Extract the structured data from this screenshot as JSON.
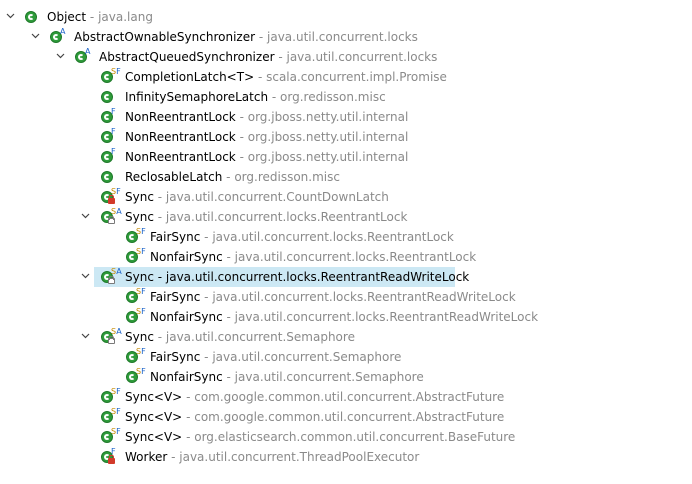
{
  "tree": {
    "rows": [
      {
        "name": "Object",
        "pkg": "- java.lang",
        "expanded": true,
        "icon": "class-icon",
        "mods": ""
      },
      {
        "name": "AbstractOwnableSynchronizer",
        "pkg": "- java.util.concurrent.locks",
        "expanded": true,
        "icon": "abstract-class-icon",
        "mods": "A"
      },
      {
        "name": "AbstractQueuedSynchronizer",
        "pkg": "- java.util.concurrent.locks",
        "expanded": true,
        "icon": "abstract-class-icon",
        "mods": "A"
      },
      {
        "name": "CompletionLatch<T>",
        "pkg": "- scala.concurrent.impl.Promise",
        "icon": "static-final-class-icon",
        "mods": "SF"
      },
      {
        "name": "InfinitySemaphoreLatch",
        "pkg": "- org.redisson.misc",
        "icon": "class-icon",
        "mods": ""
      },
      {
        "name": "NonReentrantLock",
        "pkg": "- org.jboss.netty.util.internal",
        "icon": "final-class-icon",
        "mods": "F"
      },
      {
        "name": "NonReentrantLock",
        "pkg": "- org.jboss.netty.util.internal",
        "icon": "final-class-icon",
        "mods": "F"
      },
      {
        "name": "NonReentrantLock",
        "pkg": "- org.jboss.netty.util.internal",
        "icon": "final-class-icon",
        "mods": "F"
      },
      {
        "name": "ReclosableLatch",
        "pkg": "- org.redisson.misc",
        "icon": "class-icon",
        "mods": ""
      },
      {
        "name": "Sync",
        "pkg": "- java.util.concurrent.CountDownLatch",
        "icon": "private-static-final-class-icon",
        "mods": "SF"
      },
      {
        "name": "Sync",
        "pkg": "- java.util.concurrent.locks.ReentrantLock",
        "expanded": true,
        "icon": "static-abstract-class-icon",
        "mods": "SA"
      },
      {
        "name": "FairSync",
        "pkg": "- java.util.concurrent.locks.ReentrantLock",
        "icon": "static-final-class-icon",
        "mods": "SF"
      },
      {
        "name": "NonfairSync",
        "pkg": "- java.util.concurrent.locks.ReentrantLock",
        "icon": "static-final-class-icon",
        "mods": "SF"
      },
      {
        "name": "Sync",
        "pkg": "- java.util.concurrent.locks.ReentrantReadWriteLock",
        "expanded": true,
        "selected": true,
        "icon": "static-abstract-class-icon",
        "mods": "SA"
      },
      {
        "name": "FairSync",
        "pkg": "- java.util.concurrent.locks.ReentrantReadWriteLock",
        "icon": "static-final-class-icon",
        "mods": "SF"
      },
      {
        "name": "NonfairSync",
        "pkg": "- java.util.concurrent.locks.ReentrantReadWriteLock",
        "icon": "static-final-class-icon",
        "mods": "SF"
      },
      {
        "name": "Sync",
        "pkg": "- java.util.concurrent.Semaphore",
        "expanded": true,
        "icon": "static-abstract-class-icon",
        "mods": "SA"
      },
      {
        "name": "FairSync",
        "pkg": "- java.util.concurrent.Semaphore",
        "icon": "static-final-class-icon",
        "mods": "SF"
      },
      {
        "name": "NonfairSync",
        "pkg": "- java.util.concurrent.Semaphore",
        "icon": "static-final-class-icon",
        "mods": "SF"
      },
      {
        "name": "Sync<V>",
        "pkg": "- com.google.common.util.concurrent.AbstractFuture",
        "icon": "static-final-class-icon",
        "mods": "SF"
      },
      {
        "name": "Sync<V>",
        "pkg": "- com.google.common.util.concurrent.AbstractFuture",
        "icon": "static-final-class-icon",
        "mods": "SF"
      },
      {
        "name": "Sync<V>",
        "pkg": "- org.elasticsearch.common.util.concurrent.BaseFuture",
        "icon": "static-final-class-icon",
        "mods": "SF"
      },
      {
        "name": "Worker",
        "pkg": "- java.util.concurrent.ThreadPoolExecutor",
        "icon": "private-final-class-icon",
        "mods": "F"
      }
    ]
  },
  "colors": {
    "class_green": "#2e9b3a",
    "package_gray": "#8a8a8a",
    "selection": "#cce8f4",
    "lock_red": "#d23a2a"
  }
}
